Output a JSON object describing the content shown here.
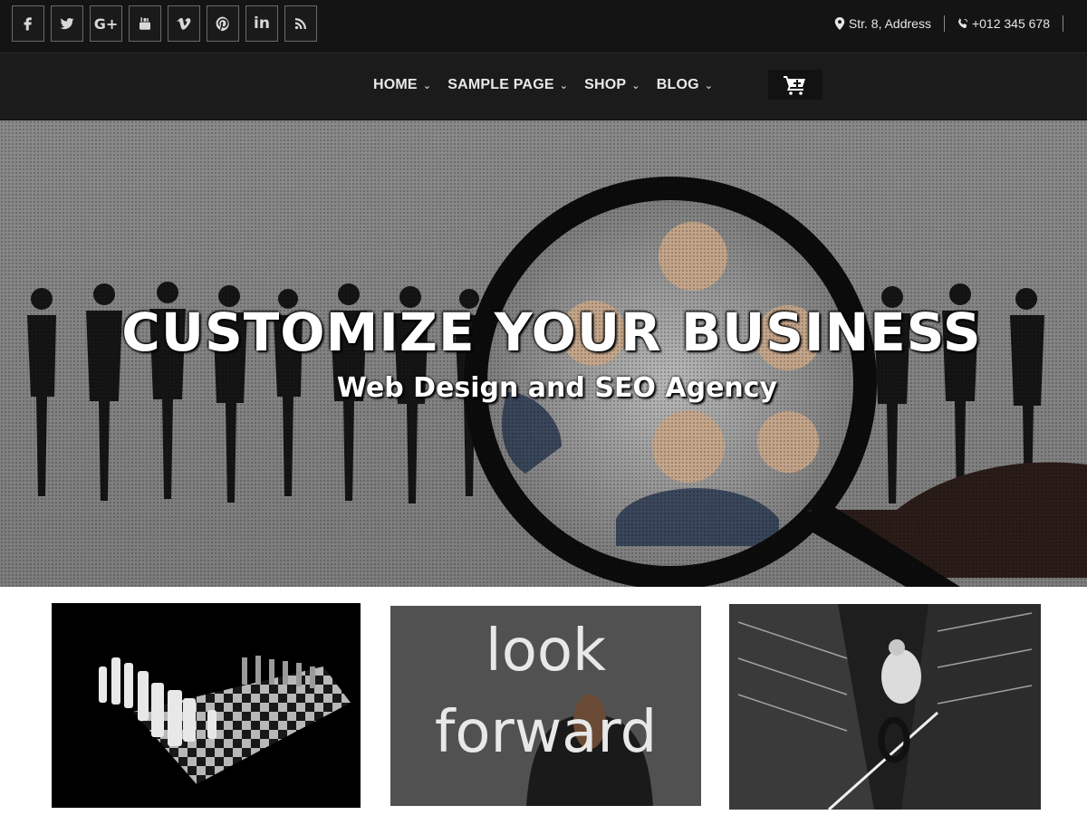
{
  "social": [
    {
      "name": "facebook-icon",
      "glyph": "f"
    },
    {
      "name": "twitter-icon",
      "glyph": "t"
    },
    {
      "name": "google-plus-icon",
      "glyph": "G+"
    },
    {
      "name": "youtube-icon",
      "glyph": "yt"
    },
    {
      "name": "vimeo-icon",
      "glyph": "v"
    },
    {
      "name": "pinterest-icon",
      "glyph": "p"
    },
    {
      "name": "linkedin-icon",
      "glyph": "in"
    },
    {
      "name": "rss-icon",
      "glyph": "rss"
    }
  ],
  "contact": {
    "address": "Str. 8, Address",
    "phone": "+012 345 678"
  },
  "nav": {
    "items": [
      {
        "label": "HOME"
      },
      {
        "label": "SAMPLE PAGE"
      },
      {
        "label": "SHOP"
      },
      {
        "label": "BLOG"
      }
    ],
    "cart_icon": "cart-icon"
  },
  "hero": {
    "title": "CUSTOMIZE YOUR BUSINESS",
    "subtitle": "Web Design and SEO Agency"
  },
  "cards": {
    "card2_line1": "look",
    "card2_line2": "forward"
  }
}
